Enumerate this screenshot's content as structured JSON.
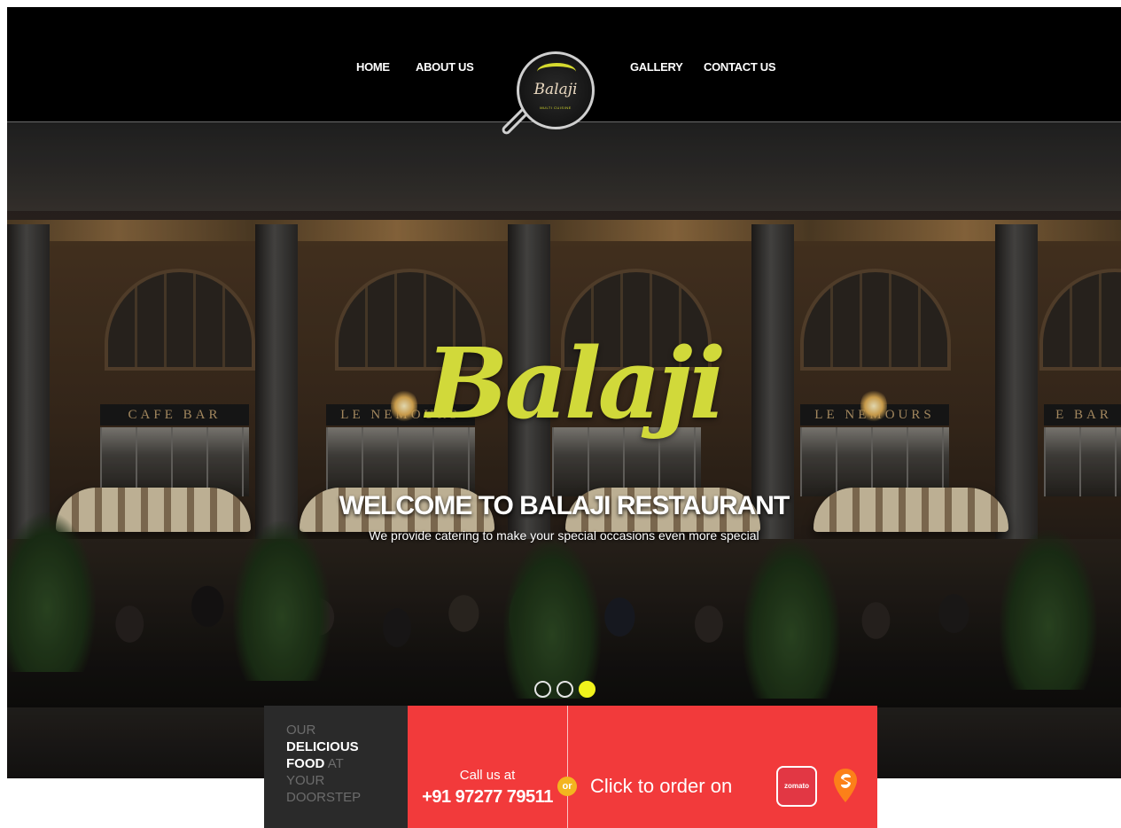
{
  "nav": {
    "home": "HOME",
    "about": "ABOUT US",
    "gallery": "GALLERY",
    "contact": "CONTACT US"
  },
  "logo": {
    "word": "Balaji",
    "subtitle": "MULTI CUISINE"
  },
  "hero": {
    "script_title": "Balaji",
    "heading": "WELCOME TO BALAJI RESTAURANT",
    "tagline": "We provide catering to make your special occasions even more special",
    "signs": [
      "CAFE BAR",
      "LE NEMOURS",
      "LE NEMOURS",
      "E BAR"
    ],
    "slider_dots": 3,
    "active_slide": 3
  },
  "promo": {
    "word1": "OUR",
    "word2": "DELICIOUS",
    "word3": "FOOD",
    "word4": "AT",
    "word5": "YOUR",
    "word6": "DOORSTEP"
  },
  "contact_bar": {
    "call_label": "Call us at",
    "phone": "+91 97277 79511",
    "or": "or",
    "order_label": "Click to order on",
    "zomato": "zomato"
  },
  "colors": {
    "accent_red": "#f23a3b",
    "accent_yellow": "#d1d93a",
    "dot_active": "#f1f21c"
  },
  "icons": {
    "zomato": "zomato-icon",
    "swiggy": "swiggy-icon"
  }
}
